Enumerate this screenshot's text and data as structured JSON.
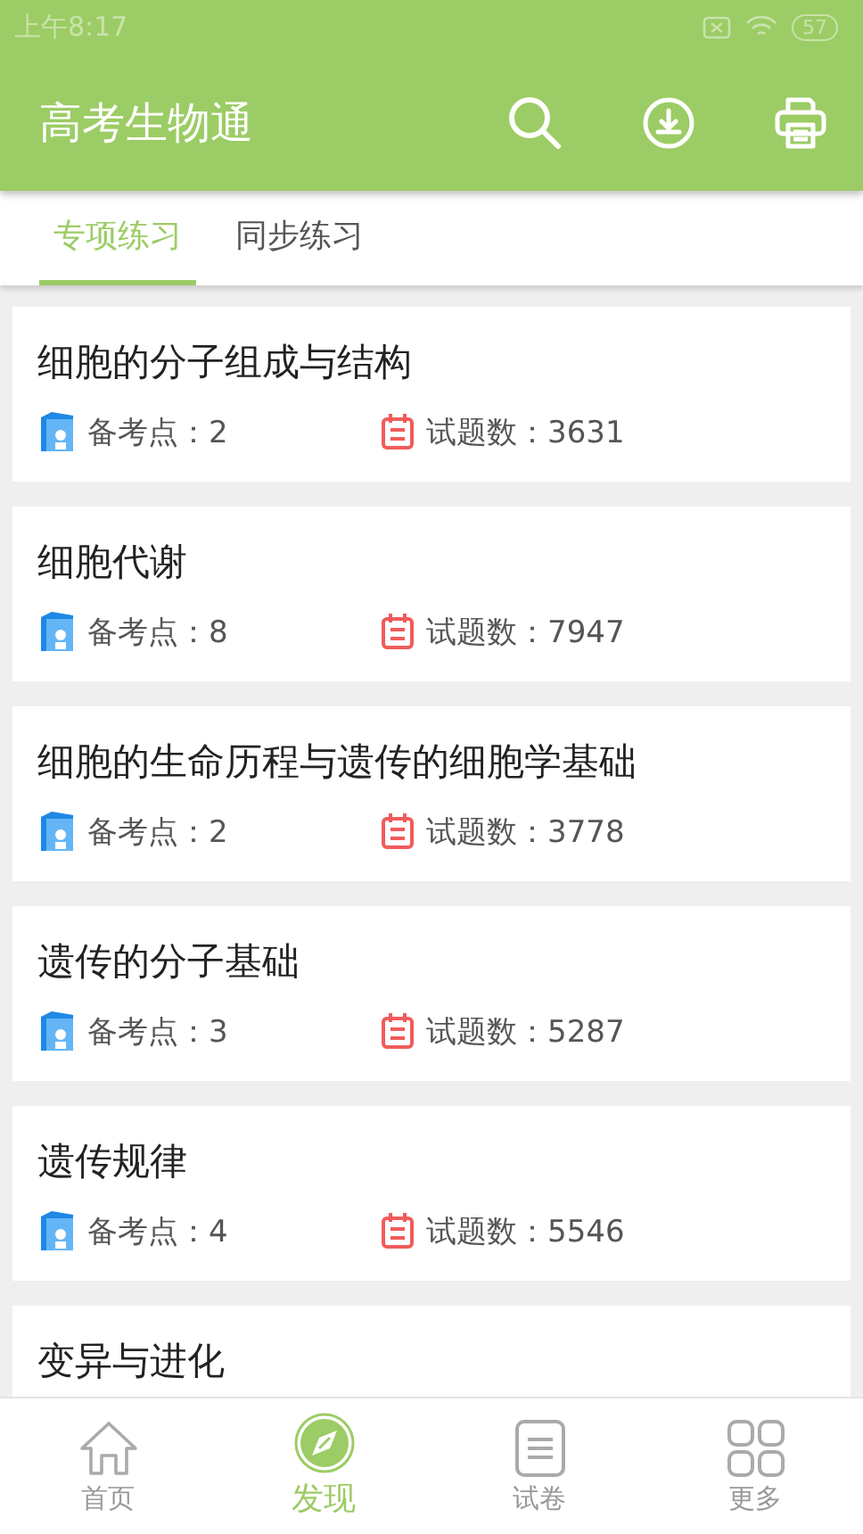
{
  "status_bar": {
    "time": "上午8:17",
    "battery": "57"
  },
  "app_bar": {
    "title": "高考生物通"
  },
  "tabs": [
    {
      "label": "专项练习",
      "selected": true
    },
    {
      "label": "同步练习",
      "selected": false
    }
  ],
  "topics": [
    {
      "title": "细胞的分子组成与结构",
      "points_label": "备考点：2",
      "questions_label": "试题数：3631"
    },
    {
      "title": "细胞代谢",
      "points_label": "备考点：8",
      "questions_label": "试题数：7947"
    },
    {
      "title": "细胞的生命历程与遗传的细胞学基础",
      "points_label": "备考点：2",
      "questions_label": "试题数：3778"
    },
    {
      "title": "遗传的分子基础",
      "points_label": "备考点：3",
      "questions_label": "试题数：5287"
    },
    {
      "title": "遗传规律",
      "points_label": "备考点：4",
      "questions_label": "试题数：5546"
    },
    {
      "title": "变异与进化"
    }
  ],
  "bottom_nav": [
    {
      "label": "首页",
      "kind": "home",
      "selected": false
    },
    {
      "label": "发现",
      "kind": "discover",
      "selected": true
    },
    {
      "label": "试卷",
      "kind": "paper",
      "selected": false
    },
    {
      "label": "更多",
      "kind": "more",
      "selected": false
    }
  ]
}
